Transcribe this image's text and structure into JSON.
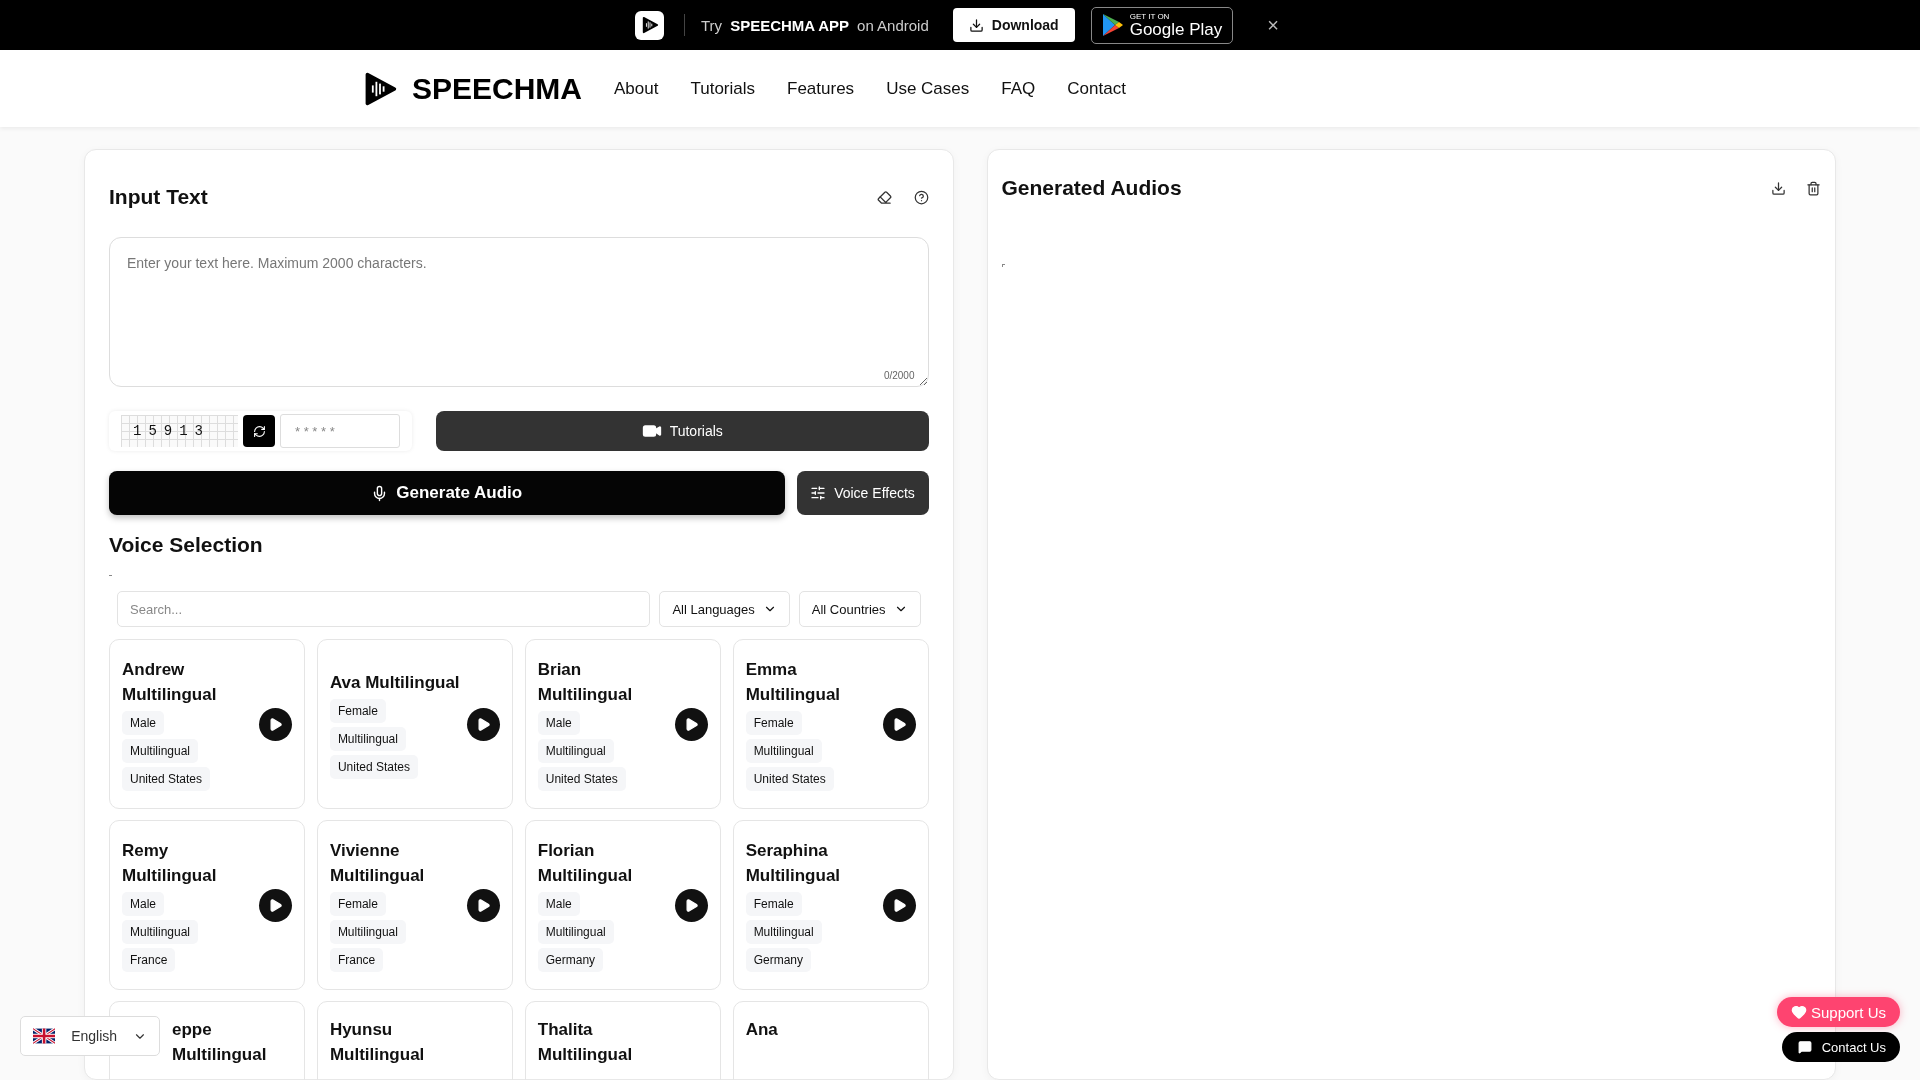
{
  "promo_bar": {
    "try": "Try",
    "app_name": "SPEECHMA APP",
    "platform": "on Android",
    "download": "Download",
    "store_small": "GET IT ON",
    "store_big": "Google Play",
    "close": "×"
  },
  "nav": {
    "brand": "SPEECHMA",
    "links": [
      "About",
      "Tutorials",
      "Features",
      "Use Cases",
      "FAQ",
      "Contact"
    ]
  },
  "input_panel": {
    "title": "Input Text",
    "placeholder": "Enter your text here. Maximum 2000 characters.",
    "counter": "0/2000",
    "captcha": "15913",
    "captcha_placeholder": "* * * * *",
    "tutorials": "Tutorials",
    "generate": "Generate Audio",
    "effects": "Voice Effects"
  },
  "voice_selection": {
    "title": "Voice Selection",
    "search_placeholder": "Search...",
    "language_filter": "All Languages",
    "country_filter": "All Countries",
    "voices": [
      {
        "name": "Andrew Multilingual",
        "tags": [
          "Male",
          "Multilingual",
          "United States"
        ]
      },
      {
        "name": "Ava Multilingual",
        "tags": [
          "Female",
          "Multilingual",
          "United States"
        ]
      },
      {
        "name": "Brian Multilingual",
        "tags": [
          "Male",
          "Multilingual",
          "United States"
        ]
      },
      {
        "name": "Emma Multilingual",
        "tags": [
          "Female",
          "Multilingual",
          "United States"
        ]
      },
      {
        "name": "Remy Multilingual",
        "tags": [
          "Male",
          "Multilingual",
          "France"
        ]
      },
      {
        "name": "Vivienne Multilingual",
        "tags": [
          "Female",
          "Multilingual",
          "France"
        ]
      },
      {
        "name": "Florian Multilingual",
        "tags": [
          "Male",
          "Multilingual",
          "Germany"
        ]
      },
      {
        "name": "Seraphina Multilingual",
        "tags": [
          "Female",
          "Multilingual",
          "Germany"
        ]
      },
      {
        "name": "eppe Multilingual"
      },
      {
        "name": "Hyunsu Multilingual"
      },
      {
        "name": "Thalita Multilingual"
      },
      {
        "name": "Ana"
      }
    ]
  },
  "output_panel": {
    "title": "Generated Audios"
  },
  "language_picker": {
    "label": "English"
  },
  "support_button": "Support Us",
  "contact_button": "Contact Us"
}
